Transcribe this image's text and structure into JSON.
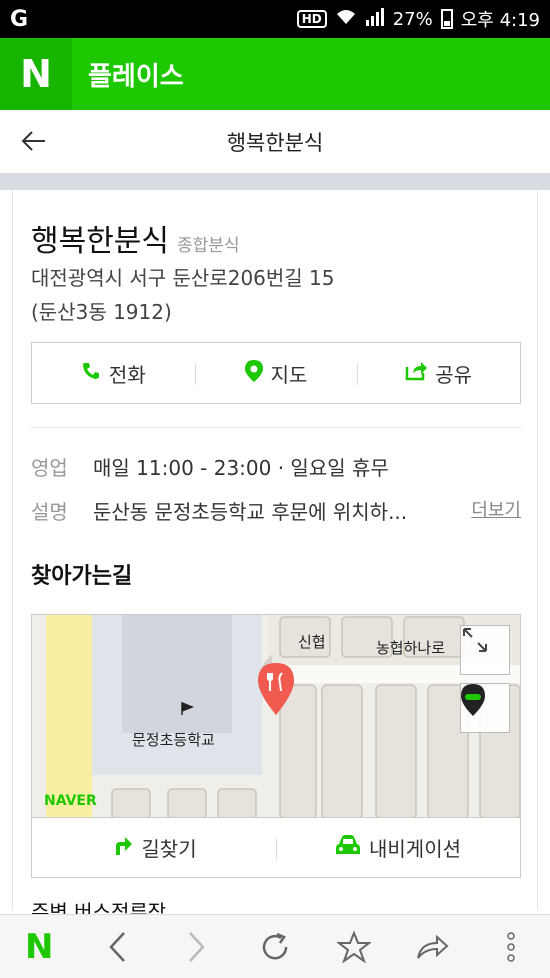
{
  "status_bar": {
    "left_icon": "g-icon",
    "hd": "HD",
    "battery": "27%",
    "time": "오후 4:19"
  },
  "app_header": {
    "logo": "N",
    "title": "플레이스"
  },
  "title_bar": {
    "back_icon": "arrow-left-icon",
    "title": "행복한분식"
  },
  "place": {
    "name": "행복한분식",
    "category": "종합분식",
    "address_line1": "대전광역시 서구 둔산로206번길 15",
    "address_line2": "(둔산3동 1912)"
  },
  "actions": [
    {
      "icon": "phone-icon",
      "label": "전화"
    },
    {
      "icon": "map-pin-icon",
      "label": "지도"
    },
    {
      "icon": "share-icon",
      "label": "공유"
    }
  ],
  "info": {
    "hours_label": "영업",
    "hours_value": "매일 11:00 - 23:00 · 일요일 휴무",
    "desc_label": "설명",
    "desc_value": "둔산동 문정초등학교 후문에 위치하...",
    "more": "더보기"
  },
  "directions": {
    "title": "찾아가는길",
    "map_labels": {
      "bank1": "신협",
      "bank2": "농협하나로",
      "school": "문정초등학교",
      "brand": "NAVER"
    },
    "route_label": "길찾기",
    "navi_label": "내비게이션"
  },
  "bus": {
    "title": "주변 버스정류장"
  },
  "bottom_bar": {
    "logo": "N",
    "back": "‹",
    "forward": "›",
    "refresh": "↻",
    "bookmark": "☆",
    "share": "↪",
    "menu": "⋮"
  },
  "colors": {
    "brand_green": "#1ec800",
    "marker_red": "#f05a4f"
  }
}
